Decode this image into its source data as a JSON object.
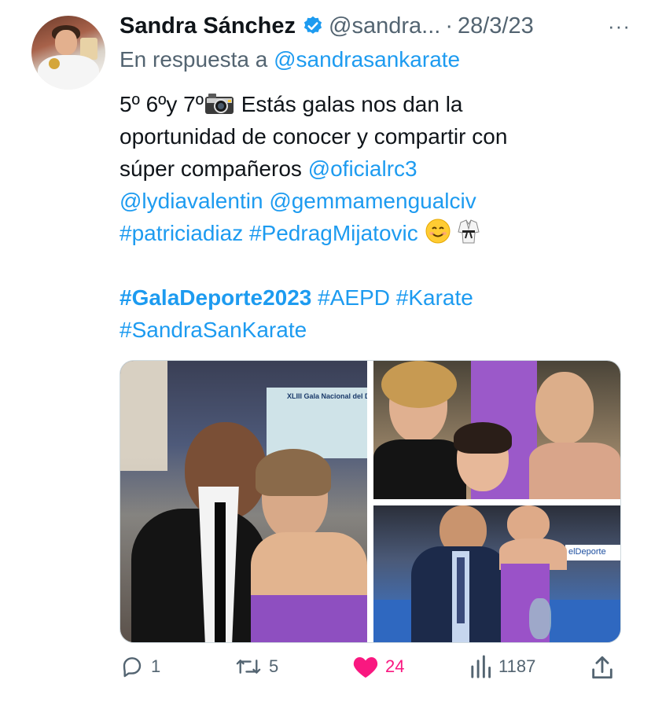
{
  "author": {
    "name": "Sandra Sánchez",
    "handle": "@sandra...",
    "separator": "·",
    "date": "28/3/23",
    "more": "···"
  },
  "reply": {
    "prefix": "En respuesta a",
    "to": "@sandrasankarate"
  },
  "tweet": {
    "l1_text": "5º 6ºy 7º",
    "l1_rest": " Estás galas nos dan la",
    "l2": "oportunidad de conocer y compartir con",
    "l3_text": "súper compañeros ",
    "l3_mention": "@oficialrc3",
    "l4_m1": "@lydiavalentin",
    "l4_m2": "@gemmamengualciv",
    "l5_h1": "#patriciadiaz",
    "l5_h2": "#PedragMijatovic",
    "l6_h1": "#GalaDeporte2023",
    "l6_h2": "#AEPD",
    "l6_h3": "#Karate",
    "l7_h1": "#SandraSanKarate"
  },
  "media": {
    "photo1_banner": "XLIII Gala Nacional del Depo",
    "photo3_banner": "elDeporte"
  },
  "actions": {
    "replies": "1",
    "retweets": "5",
    "likes": "24",
    "views": "1187"
  },
  "colors": {
    "link": "#1d9bf0",
    "like": "#f91880",
    "muted": "#536471",
    "verified": "#1d9bf0"
  },
  "icons": [
    "verified-badge-icon",
    "camera-emoji",
    "smile-emoji",
    "karate-gi-emoji",
    "reply-icon",
    "retweet-icon",
    "heart-icon",
    "views-icon",
    "share-icon",
    "more-icon"
  ]
}
